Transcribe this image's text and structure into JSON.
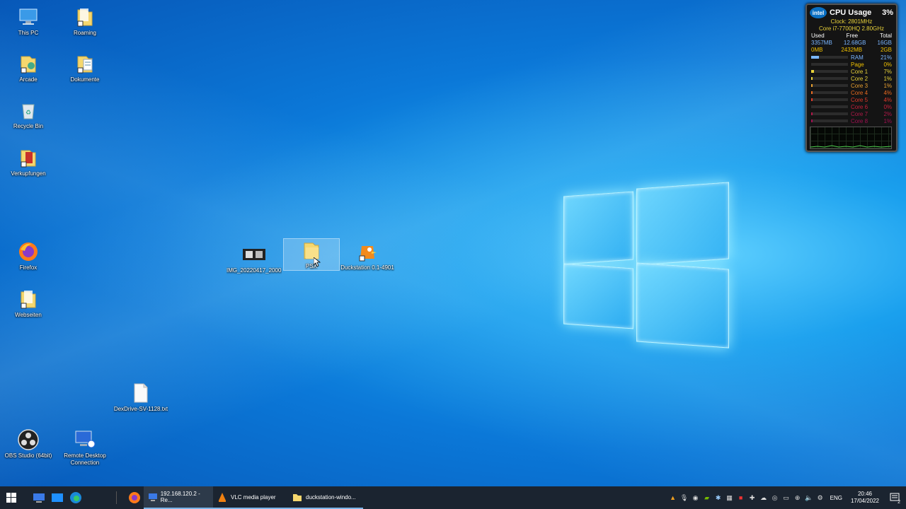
{
  "desktop": {
    "icons": [
      {
        "label": "This PC"
      },
      {
        "label": "Roaming"
      },
      {
        "label": "Arcade"
      },
      {
        "label": "Dokumente"
      },
      {
        "label": "Recycle Bin"
      },
      {
        "label": "Verkupfungen"
      },
      {
        "label": "Firefox"
      },
      {
        "label": "Webseiten"
      },
      {
        "label": "IMG_20220417_2000..."
      },
      {
        "label": "PSX"
      },
      {
        "label": "Duckstation 0.1-4901"
      },
      {
        "label": "DexDrive-SV-1128.txt"
      },
      {
        "label": "OBS Studio (64bit)"
      },
      {
        "label": "Remote Desktop Connection"
      }
    ]
  },
  "gadget": {
    "title": "CPU Usage",
    "percent": "3%",
    "clock": "Clock: 2801MHz",
    "cpu_name": "Core i7-7700HQ 2.80GHz",
    "headers": [
      "Used",
      "Free",
      "Total"
    ],
    "mem_row": [
      "3357MB",
      "12.68GB",
      "16GB"
    ],
    "page_row": [
      "0MB",
      "2432MB",
      "2GB"
    ],
    "bars": [
      {
        "name": "RAM",
        "value": "21%",
        "level": 0.21,
        "color": "#7ab6ff"
      },
      {
        "name": "Page",
        "value": "0%",
        "level": 0.0,
        "color": "#f0c000"
      },
      {
        "name": "Core 1",
        "value": "7%",
        "level": 0.07,
        "color": "#e8d23a"
      },
      {
        "name": "Core 2",
        "value": "1%",
        "level": 0.01,
        "color": "#e8d23a"
      },
      {
        "name": "Core 3",
        "value": "1%",
        "level": 0.01,
        "color": "#e8a030"
      },
      {
        "name": "Core 4",
        "value": "4%",
        "level": 0.04,
        "color": "#e86a20"
      },
      {
        "name": "Core 5",
        "value": "4%",
        "level": 0.04,
        "color": "#e03a2a"
      },
      {
        "name": "Core 6",
        "value": "0%",
        "level": 0.0,
        "color": "#c8203a"
      },
      {
        "name": "Core 7",
        "value": "2%",
        "level": 0.02,
        "color": "#b01848"
      },
      {
        "name": "Core 8",
        "value": "1%",
        "level": 0.01,
        "color": "#a01050"
      }
    ]
  },
  "taskbar": {
    "apps": [
      {
        "label": "192.168.120.2 - Re..."
      },
      {
        "label": "VLC media player"
      },
      {
        "label": "duckstation-windo..."
      }
    ],
    "lang": "ENG",
    "time": "20:46",
    "date": "17/04/2022",
    "notification_count": "2"
  }
}
